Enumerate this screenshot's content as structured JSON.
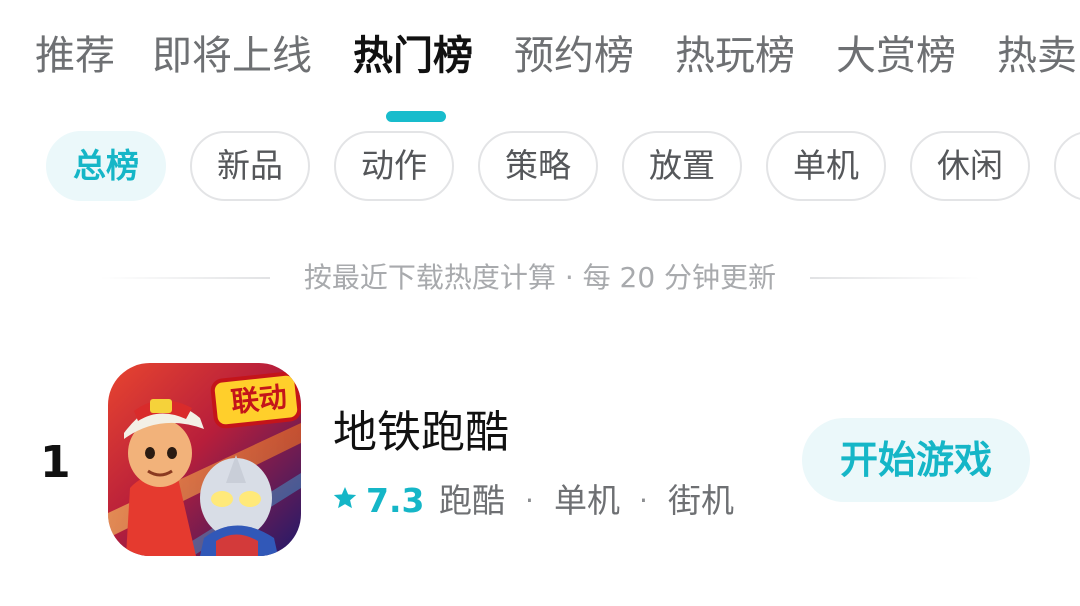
{
  "tabs": [
    {
      "label": "推荐",
      "active": false
    },
    {
      "label": "即将上线",
      "active": false
    },
    {
      "label": "热门榜",
      "active": true
    },
    {
      "label": "预约榜",
      "active": false
    },
    {
      "label": "热玩榜",
      "active": false
    },
    {
      "label": "大赏榜",
      "active": false
    },
    {
      "label": "热卖",
      "active": false
    }
  ],
  "chips": [
    {
      "label": "总榜",
      "active": true
    },
    {
      "label": "新品",
      "active": false
    },
    {
      "label": "动作",
      "active": false
    },
    {
      "label": "策略",
      "active": false
    },
    {
      "label": "放置",
      "active": false
    },
    {
      "label": "单机",
      "active": false
    },
    {
      "label": "休闲",
      "active": false
    }
  ],
  "note": "按最近下载热度计算 · 每 20 分钟更新",
  "games": [
    {
      "rank": "1",
      "title": "地铁跑酷",
      "icon": "subway-surfers-game-icon",
      "icon_badge": "联动",
      "rating": "7.3",
      "tags": [
        "跑酷",
        "单机",
        "街机"
      ],
      "tag_separator": "·",
      "action_label": "开始游戏"
    }
  ],
  "colors": {
    "accent": "#15b6c7",
    "accent_bg": "#ebf8fa",
    "indicator": "#18bccc",
    "text_primary": "#111111",
    "text_secondary": "#6e7073",
    "note_text": "#a8aaad",
    "chip_border": "#e3e4e6"
  }
}
